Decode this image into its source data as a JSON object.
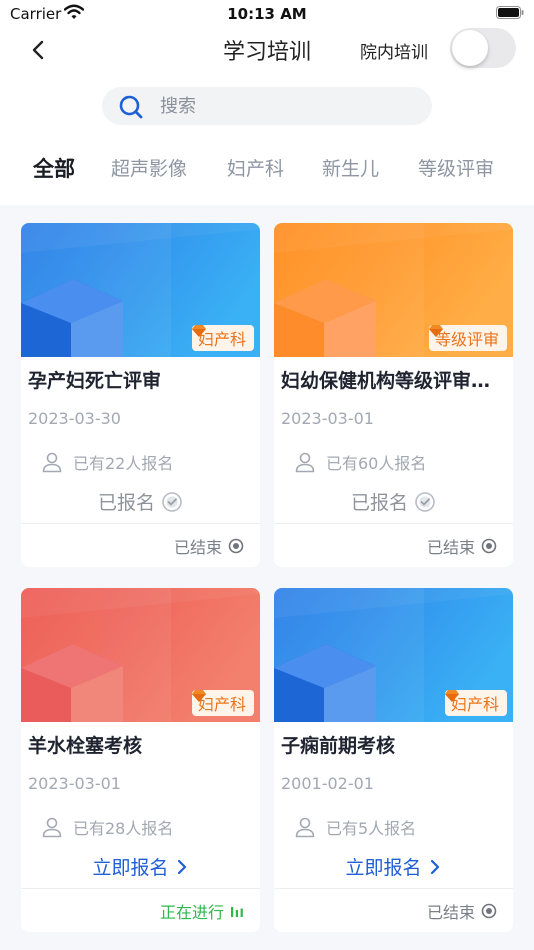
{
  "status_bar": {
    "carrier": "Carrier",
    "time": "10:13 AM"
  },
  "nav": {
    "title": "学习培训",
    "toggle_label": "院内培训",
    "toggle_on": false
  },
  "search": {
    "placeholder": "搜索",
    "value": ""
  },
  "tabs": [
    {
      "label": "全部",
      "active": true
    },
    {
      "label": "超声影像",
      "active": false
    },
    {
      "label": "妇产科",
      "active": false
    },
    {
      "label": "新生儿",
      "active": false
    },
    {
      "label": "等级评审",
      "active": false
    }
  ],
  "theme": {
    "accent": "#1f5fd6",
    "tag_text": "#e8741c",
    "running": "#2fb84a",
    "banner_blue": [
      "#2f7fe6",
      "#3aa8f2"
    ],
    "banner_orange": [
      "#ff8a1a",
      "#ffae4a"
    ],
    "banner_red": [
      "#ee5a55",
      "#f37f6a"
    ]
  },
  "cards": [
    {
      "title": "孕产妇死亡评审",
      "date": "2023-03-30",
      "count_text": "已有22人报名",
      "tag": "妇产科",
      "banner": "blue",
      "action": "已报名",
      "action_type": "registered",
      "status": "已结束",
      "status_type": "ended"
    },
    {
      "title": "妇幼保健机构等级评审…",
      "date": "2023-03-01",
      "count_text": "已有60人报名",
      "tag": "等级评审",
      "banner": "orange",
      "action": "已报名",
      "action_type": "registered",
      "status": "已结束",
      "status_type": "ended"
    },
    {
      "title": "羊水栓塞考核",
      "date": "2023-03-01",
      "count_text": "已有28人报名",
      "tag": "妇产科",
      "banner": "red",
      "action": "立即报名",
      "action_type": "signup",
      "status": "正在进行",
      "status_type": "running"
    },
    {
      "title": "子痫前期考核",
      "date": "2001-02-01",
      "count_text": "已有5人报名",
      "tag": "妇产科",
      "banner": "blue",
      "action": "立即报名",
      "action_type": "signup",
      "status": "已结束",
      "status_type": "ended"
    }
  ]
}
